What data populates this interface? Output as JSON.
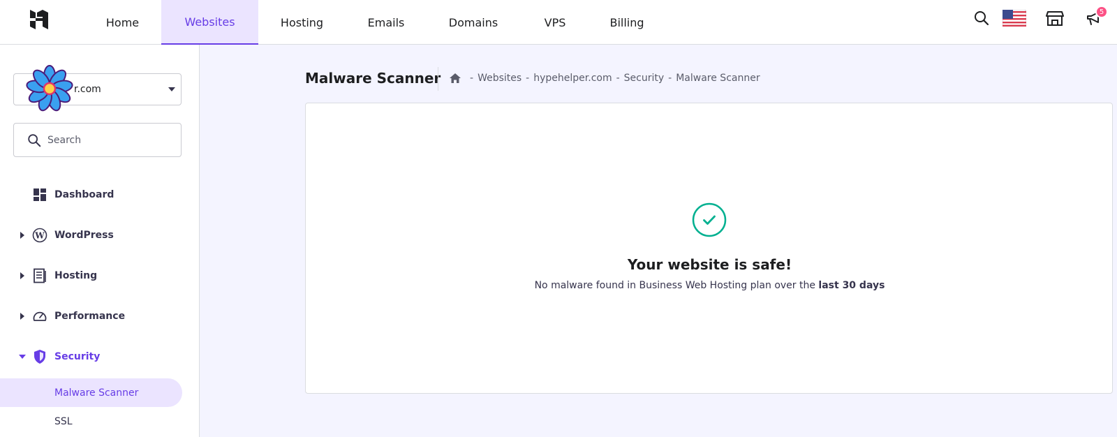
{
  "topnav": {
    "items": [
      {
        "label": "Home"
      },
      {
        "label": "Websites"
      },
      {
        "label": "Hosting"
      },
      {
        "label": "Emails"
      },
      {
        "label": "Domains"
      },
      {
        "label": "VPS"
      },
      {
        "label": "Billing"
      }
    ],
    "active": "Websites",
    "notifications_count": "5",
    "icons": [
      "search-icon",
      "us-flag-icon",
      "store-icon",
      "megaphone-icon"
    ]
  },
  "sidebar": {
    "site_selector_value": "r.com",
    "search_placeholder": "Search",
    "menu": [
      {
        "label": "Dashboard",
        "icon": "dashboard-icon"
      },
      {
        "label": "WordPress",
        "icon": "wordpress-icon"
      },
      {
        "label": "Hosting",
        "icon": "hosting-icon"
      },
      {
        "label": "Performance",
        "icon": "speedometer-icon"
      },
      {
        "label": "Security",
        "icon": "shield-icon",
        "expanded": true
      }
    ],
    "submenu": [
      {
        "label": "Malware Scanner",
        "active": true
      },
      {
        "label": "SSL"
      }
    ]
  },
  "main": {
    "title": "Malware Scanner",
    "breadcrumb": [
      "Websites",
      "hypehelper.com",
      "Security",
      "Malware Scanner"
    ],
    "card": {
      "heading": "Your website is safe!",
      "description": "No malware found in Business Web Hosting plan over the",
      "description_bold": "last 30 days"
    }
  },
  "colors": {
    "accent": "#673de6",
    "accent_light": "#ebe4ff",
    "success": "#00b090",
    "badge": "#fc5185"
  }
}
